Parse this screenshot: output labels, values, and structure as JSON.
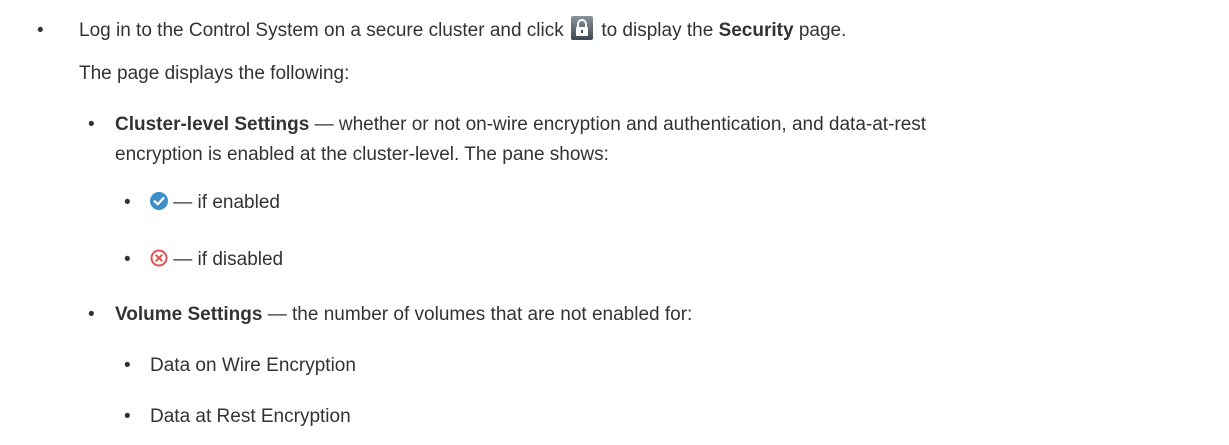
{
  "step": {
    "text_before_icon": "Log in to the Control System on a secure cluster and click",
    "icon": "lock-icon",
    "text_after_icon": "to display the",
    "page_name": "Security",
    "text_end": "page.",
    "followup": "The page displays the following:"
  },
  "items": [
    {
      "title": "Cluster-level Settings",
      "description_line1": "— whether or not on-wire encryption and authentication, and data-at-rest",
      "description_line2": "encryption is enabled at the cluster-level. The pane shows:",
      "subitems": [
        {
          "icon": "check-circle-icon",
          "text": "— if enabled",
          "color": "#3d8fcc"
        },
        {
          "icon": "x-circle-icon",
          "text": "— if disabled",
          "color": "#e05252"
        }
      ]
    },
    {
      "title": "Volume Settings",
      "description": "— the number of volumes that are not enabled for:",
      "subitems": [
        {
          "text": "Data on Wire Encryption"
        },
        {
          "text": "Data at Rest Encryption"
        }
      ]
    }
  ],
  "bullet_char": "•"
}
